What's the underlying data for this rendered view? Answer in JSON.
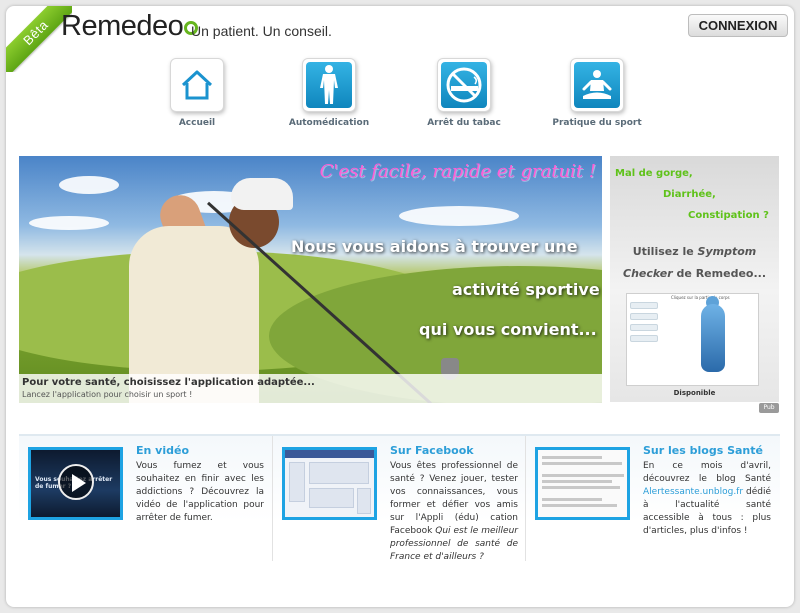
{
  "header": {
    "beta": "Bêta",
    "logo": "Remedeo",
    "tagline": "Un patient. Un conseil.",
    "connexion": "CONNEXION"
  },
  "nav": [
    {
      "label": "Accueil",
      "icon": "home-icon"
    },
    {
      "label": "Automédication",
      "icon": "human-body-icon"
    },
    {
      "label": "Arrêt du tabac",
      "icon": "no-smoking-icon"
    },
    {
      "label": "Pratique du sport",
      "icon": "meditation-icon"
    }
  ],
  "banner": {
    "slogan": "C'est facile, rapide et gratuit !",
    "line1": "Nous vous aidons à trouver une",
    "line2": "activité sportive",
    "line3": "qui vous convient...",
    "caption_title": "Pour votre santé, choisissez l'application adaptée...",
    "caption_sub": "Lancez l'application pour choisir un sport !"
  },
  "ad": {
    "green1": "Mal de gorge,",
    "green2": "Diarrhée,",
    "green3": "Constipation ?",
    "text1": "Utilisez le",
    "text1_italic": "Symptom",
    "text2_italic": "Checker",
    "text2": "de Remedeo...",
    "shot_title": "Cliquez sur la partie du corps",
    "available": "Disponible",
    "pub": "Pub"
  },
  "cards": [
    {
      "title": "En vidéo",
      "text": "Vous fumez et vous souhaitez en finir avec les addictions ? Découvrez la vidéo de l'application pour arrêter de fumer.",
      "thumb_text": "Vous souhaitez arrêter de fumer ?"
    },
    {
      "title": "Sur Facebook",
      "text": "Vous êtes professionnel de santé ? Venez jouer, tester vos connaissances, vous former et défier vos amis sur l'Appli (édu) cation Facebook",
      "text_italic": "Qui est le meilleur professionnel de santé de France et d'ailleurs ?"
    },
    {
      "title": "Sur les blogs Santé",
      "text_before": "En ce mois d'avril, découvrez le blog Santé",
      "link": "Alertessante.unblog.fr",
      "text_after": "dédié à l'actualité santé accessible à tous : plus d'articles, plus d'infos !"
    }
  ],
  "colors": {
    "brand_green": "#66b51e",
    "accent_blue": "#2d9ed8",
    "slogan_pink": "#ff5fd6"
  }
}
